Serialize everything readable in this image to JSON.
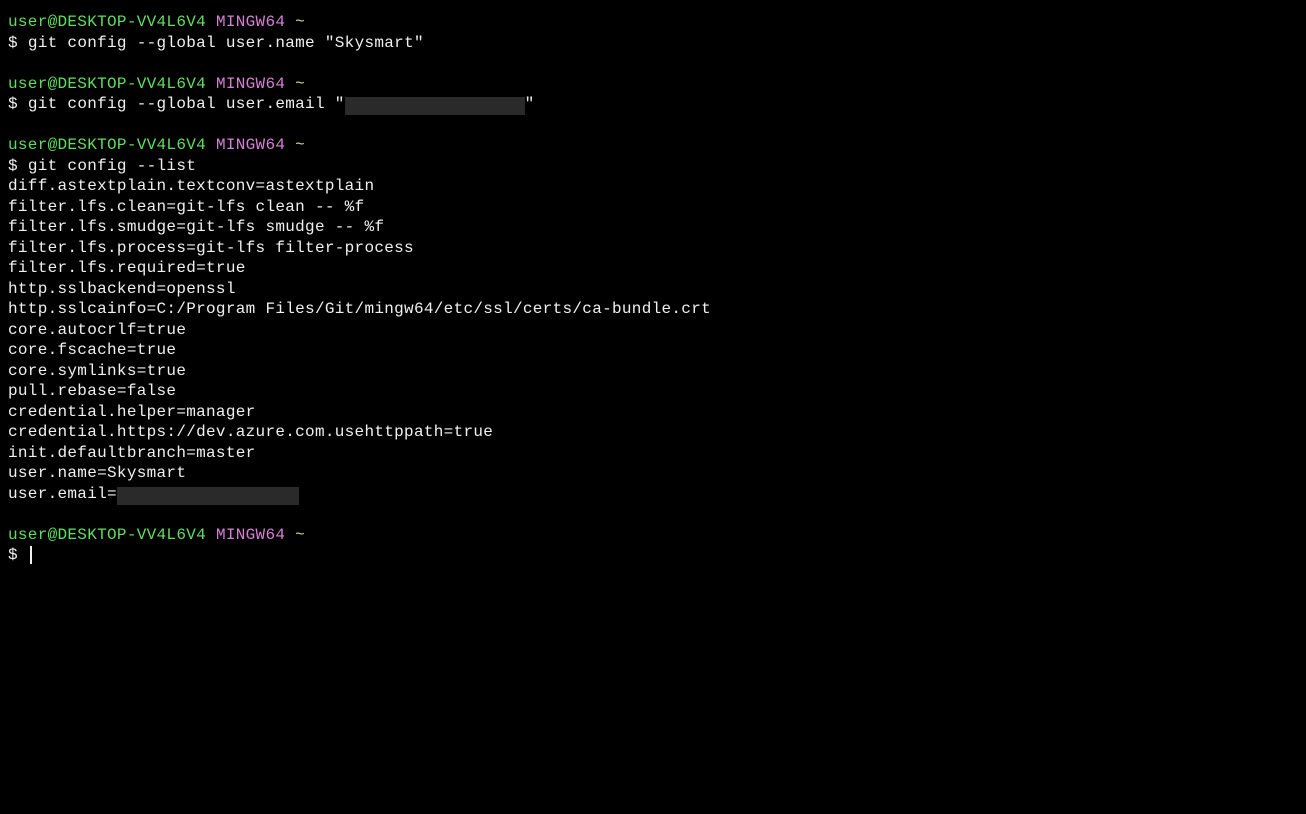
{
  "prompt": {
    "user": "user@DESKTOP-VV4L6V4",
    "env": "MINGW64",
    "path": "~",
    "dollar": "$"
  },
  "blocks": [
    {
      "command": "git config --global user.name \"Skysmart\"",
      "output": []
    },
    {
      "command_pre": "git config --global user.email \"",
      "command_post": "\"",
      "redacted": true,
      "output": []
    },
    {
      "command": "git config --list",
      "output": [
        "diff.astextplain.textconv=astextplain",
        "filter.lfs.clean=git-lfs clean -- %f",
        "filter.lfs.smudge=git-lfs smudge -- %f",
        "filter.lfs.process=git-lfs filter-process",
        "filter.lfs.required=true",
        "http.sslbackend=openssl",
        "http.sslcainfo=C:/Program Files/Git/mingw64/etc/ssl/certs/ca-bundle.crt",
        "core.autocrlf=true",
        "core.fscache=true",
        "core.symlinks=true",
        "pull.rebase=false",
        "credential.helper=manager",
        "credential.https://dev.azure.com.usehttppath=true",
        "init.defaultbranch=master",
        "user.name=Skysmart"
      ],
      "output_trailing_redacted": {
        "prefix": "user.email="
      }
    }
  ]
}
